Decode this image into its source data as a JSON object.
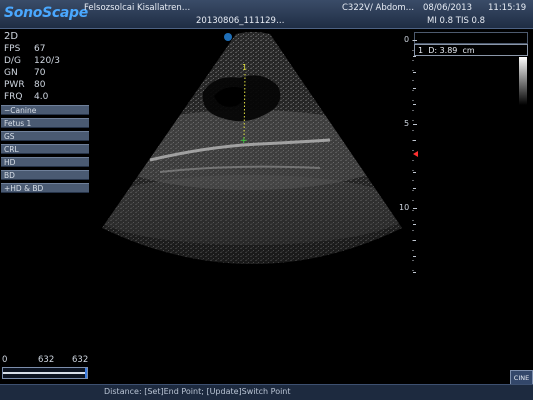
{
  "header": {
    "logo": "SonoScape",
    "institution": "Felsozsolcai Kisallatren…",
    "probe_preset": "C322V/ Abdom…",
    "date": "08/06/2013",
    "time": "11:15:19",
    "patient_id": "20130806_111129…",
    "mi_tis": "MI 0.8 TIS 0.8"
  },
  "params": {
    "mode": "2D",
    "items": [
      {
        "label": "FPS",
        "value": "67"
      },
      {
        "label": "D/G",
        "value": "120/3"
      },
      {
        "label": "GN",
        "value": "70"
      },
      {
        "label": "PWR",
        "value": "80"
      },
      {
        "label": "FRQ",
        "value": "4.0"
      }
    ]
  },
  "menu": {
    "items": [
      "−Canine",
      "Fetus 1",
      "GS",
      "CRL",
      "HD",
      "BD",
      "+HD & BD"
    ]
  },
  "measurement": {
    "index": "1",
    "label": "D: 3.89",
    "unit": "cm",
    "caliper_start": "1",
    "caliper_end": "+"
  },
  "depth_scale": {
    "labels": [
      "0",
      "5",
      "10"
    ]
  },
  "bottom": {
    "scale_left": "0",
    "scale_mid": "632",
    "scale_right": "632",
    "status": "Distance: [Set]End Point; [Update]Switch Point",
    "cine_label": "CINE"
  },
  "colors": {
    "header_bg": "#2b3a55",
    "logo": "#4aa8ff",
    "caliper": "#e0e040",
    "focus_marker": "#ff3030"
  }
}
